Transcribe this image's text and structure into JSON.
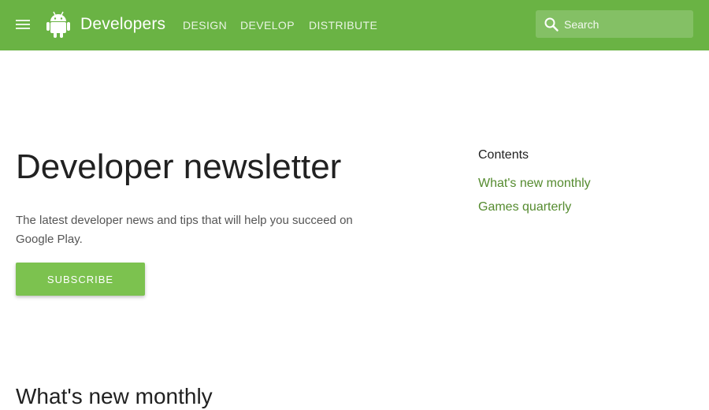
{
  "colors": {
    "topbar": "#6ab344",
    "button": "#7cc24f",
    "link": "#558b2f",
    "text": "#212121"
  },
  "header": {
    "menu_icon": "hamburger-menu-icon",
    "logo_icon": "android-robot-icon",
    "brand": "Developers",
    "nav": [
      {
        "label": "DESIGN"
      },
      {
        "label": "DEVELOP"
      },
      {
        "label": "DISTRIBUTE"
      }
    ],
    "search": {
      "icon": "search-icon",
      "placeholder": "Search"
    }
  },
  "main": {
    "title": "Developer newsletter",
    "intro": "The latest developer news and tips that will help you succeed on Google Play.",
    "subscribe_label": "SUBSCRIBE",
    "section_heading": "What's new monthly"
  },
  "contents": {
    "title": "Contents",
    "links": [
      {
        "label": "What's new monthly"
      },
      {
        "label": "Games quarterly"
      }
    ]
  }
}
